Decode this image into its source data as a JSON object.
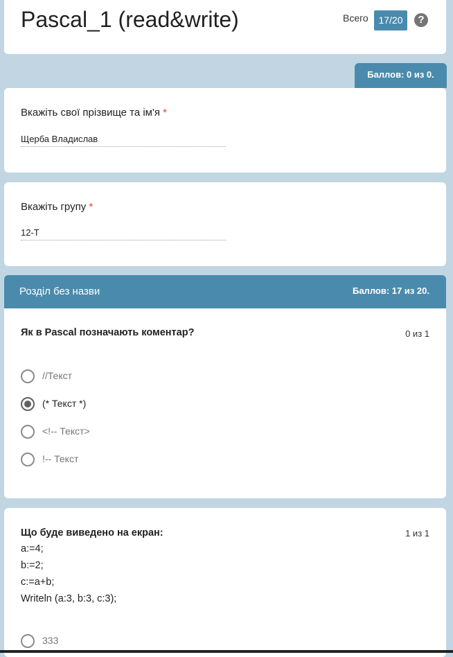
{
  "header": {
    "title": "Pascal_1 (read&write)",
    "total_label": "Всего",
    "total_value": "17/20",
    "help_icon": "?"
  },
  "score_tab": "Баллов: 0 из 0.",
  "fields": [
    {
      "label": "Вкажіть  свої прізвище та ім'я",
      "required_mark": "*",
      "value": "Щерба Владислав"
    },
    {
      "label": "Вкажіть групу",
      "required_mark": "*",
      "value": "12-Т"
    }
  ],
  "section": {
    "title": "Розділ без назви",
    "score": "Баллов: 17 из 20."
  },
  "questions": [
    {
      "title": "Як в Pascal позначають коментар?",
      "points": "0 из 1",
      "options": [
        {
          "label": "//Текст",
          "selected": false
        },
        {
          "label": "(* Текст *)",
          "selected": true
        },
        {
          "label": "<!-- Текст>",
          "selected": false
        },
        {
          "label": "!-- Текст",
          "selected": false
        }
      ]
    },
    {
      "title": "Що буде виведено на екран:",
      "points": "1 из 1",
      "code": [
        "a:=4;",
        "b:=2;",
        "c:=a+b;",
        "Writeln (a:3, b:3, c:3);"
      ],
      "options": [
        {
          "label": "333",
          "selected": false
        }
      ]
    }
  ]
}
